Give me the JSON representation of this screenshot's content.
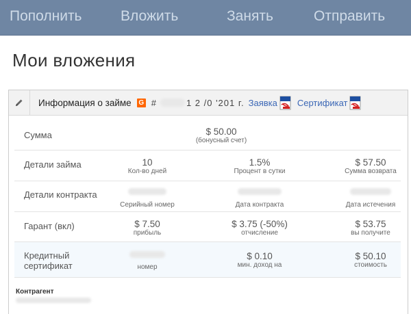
{
  "nav": {
    "items": [
      "Пополнить",
      "Вложить",
      "Занять",
      "Отправить"
    ]
  },
  "page_title": "Мои вложения",
  "panel": {
    "header": {
      "title": "Информация о займе",
      "badge": "G",
      "hash": "#",
      "date_text": "1 2 /0 '201 г.",
      "request_link": "Заявка",
      "certificate_link": "Сертификат"
    },
    "rows": [
      {
        "label": "Сумма",
        "cells": [
          {
            "value": "$ 50.00",
            "sub": "(бонусный счет)"
          }
        ]
      },
      {
        "label": "Детали займа",
        "cells": [
          {
            "value": "10",
            "sub": "Кол-во дней"
          },
          {
            "value": "1.5%",
            "sub": "Процент в сутки"
          },
          {
            "value": "$ 57.50",
            "sub": "Сумма возврата"
          }
        ]
      },
      {
        "label": "Детали контракта",
        "cells": [
          {
            "value": "",
            "sub": "Серийный номер"
          },
          {
            "value": "",
            "sub": "Дата контракта"
          },
          {
            "value": "",
            "sub": "Дата истечения"
          }
        ]
      },
      {
        "label": "Гарант (вкл)",
        "cells": [
          {
            "value": "$ 7.50",
            "sub": "прибыль"
          },
          {
            "value": "$ 3.75 (-50%)",
            "sub": "отчисление"
          },
          {
            "value": "$ 53.75",
            "sub": "вы получите"
          }
        ]
      },
      {
        "label": "Кредитный сертификат",
        "cells": [
          {
            "value": "",
            "sub": "номер"
          },
          {
            "value": "$ 0.10",
            "sub": "мин. доход на"
          },
          {
            "value": "$ 50.10",
            "sub": "стоимость"
          }
        ]
      }
    ],
    "counterparty_label": "Контрагент"
  },
  "colors": {
    "nav_bg": "#6f86a3",
    "nav_text": "#cfdbe8",
    "link": "#3a66b5",
    "badge": "#ff6600"
  }
}
